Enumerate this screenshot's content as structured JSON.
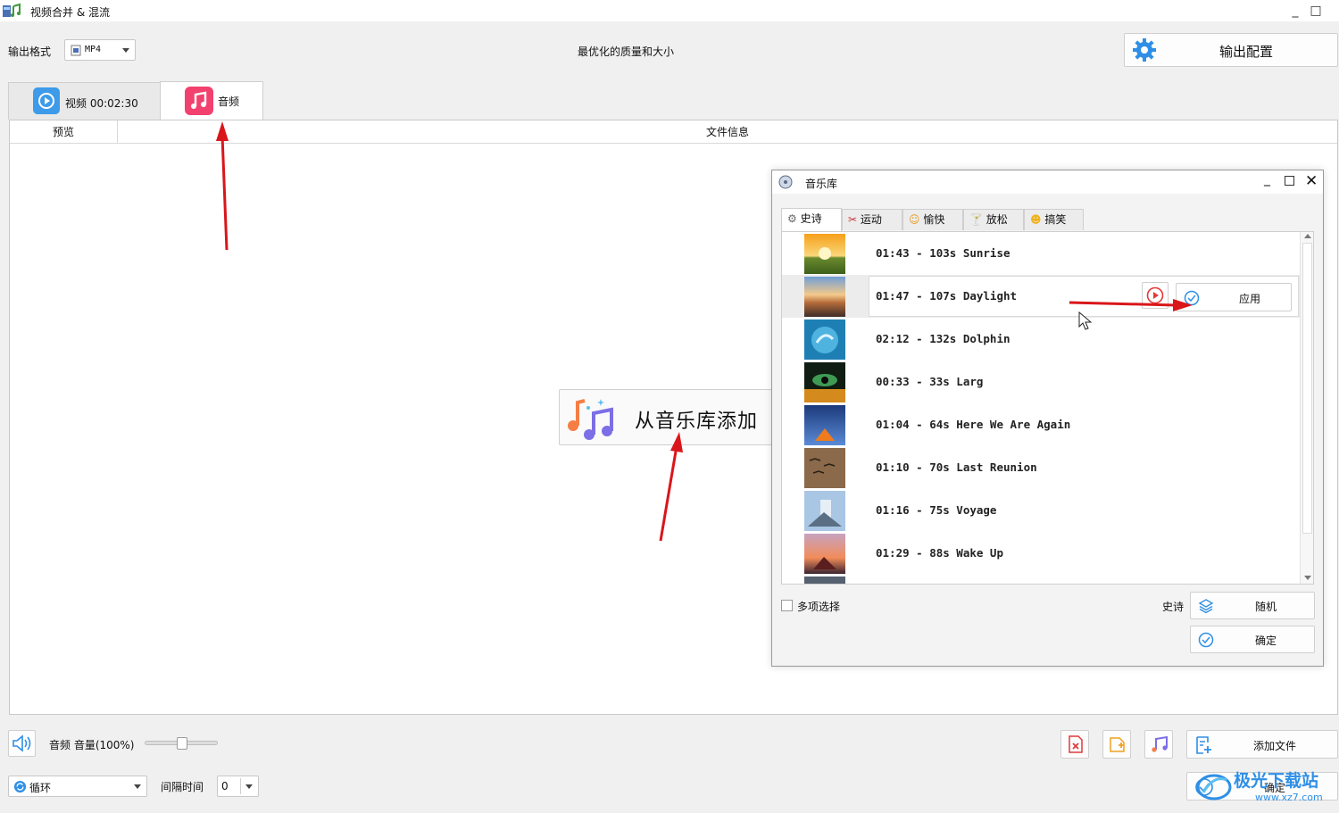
{
  "window": {
    "title": "视频合并 & 混流",
    "minimize": "_",
    "maximize": "□"
  },
  "toolbar": {
    "output_format_label": "输出格式",
    "output_format_value": "MP4",
    "quality_text": "最优化的质量和大小",
    "output_config_label": "输出配置"
  },
  "tabs": {
    "video_label": "视频 00:02:30",
    "audio_label": "音频"
  },
  "table": {
    "col_preview": "预览",
    "col_fileinfo": "文件信息"
  },
  "add_from_library": "从音乐库添加",
  "dialog": {
    "title": "音乐库",
    "tabs": [
      "史诗",
      "运动",
      "愉快",
      "放松",
      "搞笑"
    ],
    "tracks": [
      {
        "text": "01:43 - 103s Sunrise"
      },
      {
        "text": "01:47 - 107s Daylight"
      },
      {
        "text": "02:12 - 132s Dolphin"
      },
      {
        "text": "00:33 - 33s Larg"
      },
      {
        "text": "01:04 - 64s Here We Are Again"
      },
      {
        "text": "01:10 - 70s Last Reunion"
      },
      {
        "text": "01:16 - 75s Voyage"
      },
      {
        "text": "01:29 - 88s Wake Up"
      }
    ],
    "apply_label": "应用",
    "multi_select_label": "多项选择",
    "category_label": "史诗",
    "random_label": "随机",
    "confirm_label": "确定"
  },
  "bottom": {
    "volume_label": "音频 音量(100%)",
    "volume_level": 0.5,
    "loop_value": "循环",
    "interval_label": "间隔时间",
    "interval_value": "0",
    "add_file_label": "添加文件",
    "confirm_label": "确定"
  },
  "watermark": {
    "text": "极光下载站",
    "url": "www.xz7.com"
  },
  "colors": {
    "accent_blue": "#2f8fe6",
    "music_pink": "#f2416e",
    "arrow_red": "#d9161a"
  }
}
